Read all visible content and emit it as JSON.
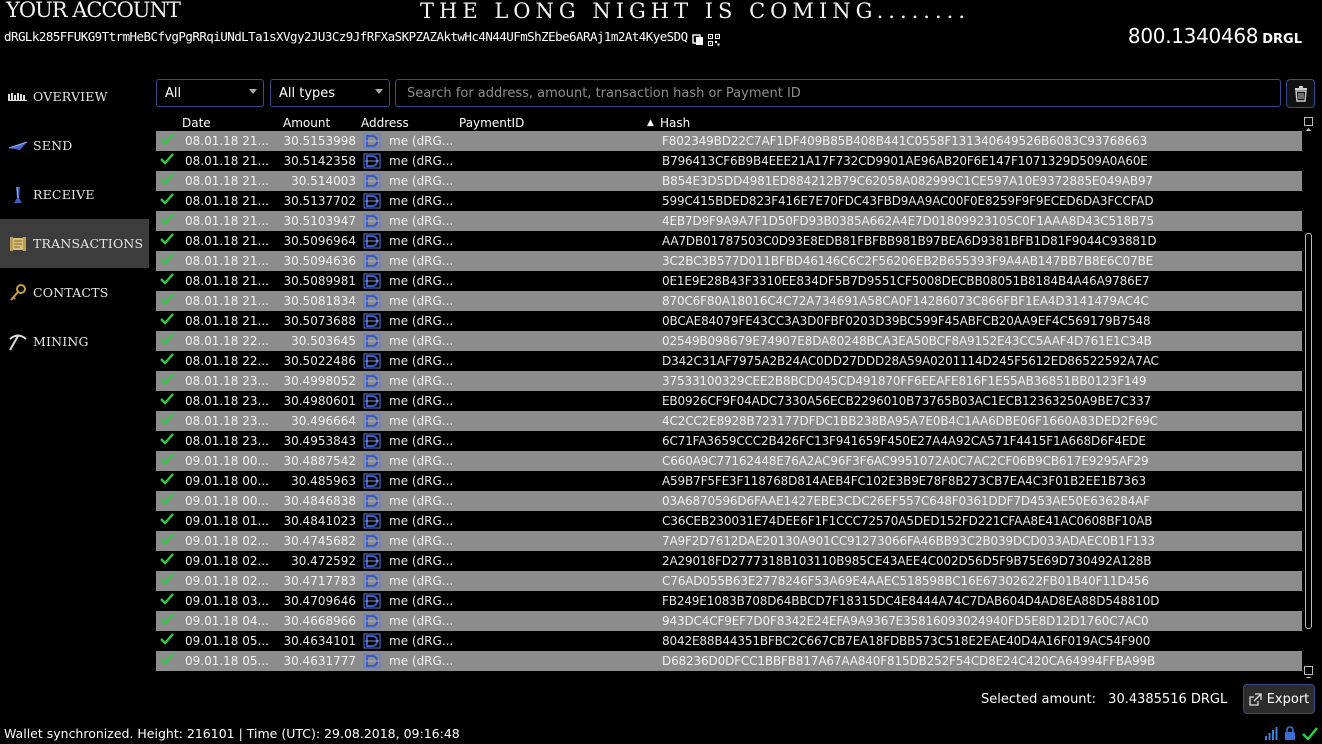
{
  "header": {
    "title": "YOUR ACCOUNT",
    "tagline": "THE LONG NIGHT IS COMING........",
    "address": "dRGLk285FFUKG9TtrmHeBCfvgPgRRqiUNdLTa1sXVgy2JU3Cz9JfRFXaSKPZAZAktwHc4N44UFmShZEbe6ARAj1m2At4KyeSDQ",
    "balance": "800.1340468",
    "ticker": "DRGL"
  },
  "sidebar": {
    "items": [
      {
        "label": "OVERVIEW",
        "icon": "overview-icon"
      },
      {
        "label": "SEND",
        "icon": "send-icon"
      },
      {
        "label": "RECEIVE",
        "icon": "receive-icon"
      },
      {
        "label": "TRANSACTIONS",
        "icon": "transactions-icon",
        "active": true
      },
      {
        "label": "CONTACTS",
        "icon": "contacts-icon"
      },
      {
        "label": "MINING",
        "icon": "mining-icon"
      }
    ]
  },
  "filters": {
    "period": "All",
    "type": "All types",
    "search_placeholder": "Search for address, amount, transaction hash or Payment ID"
  },
  "table": {
    "headers": {
      "date": "Date",
      "amount": "Amount",
      "address": "Address",
      "payment_id": "PaymentID",
      "hash": "Hash"
    },
    "rows": [
      {
        "date": "08.01.18 21...",
        "amount": "30.5153998",
        "address": "me (dRG...",
        "hash": "F802349BD22C7AF1DF409B85B408B441C0558F131340649526B6083C93768663"
      },
      {
        "date": "08.01.18 21...",
        "amount": "30.5142358",
        "address": "me (dRG...",
        "hash": "B796413CF6B9B4EEE21A17F732CD9901AE96AB20F6E147F1071329D509A0A60E"
      },
      {
        "date": "08.01.18 21...",
        "amount": "30.514003",
        "address": "me (dRG...",
        "hash": "B854E3D5DD4981ED884212B79C62058A082999C1CE597A10E9372885E049AB97"
      },
      {
        "date": "08.01.18 21...",
        "amount": "30.5137702",
        "address": "me (dRG...",
        "hash": "599C415BDED823F416E7E70FDC43FBD9AA9AC00F0E8259F9F9ECED6DA3FCCFAD"
      },
      {
        "date": "08.01.18 21...",
        "amount": "30.5103947",
        "address": "me (dRG...",
        "hash": "4EB7D9F9A9A7F1D50FD93B0385A662A4E7D01809923105C0F1AAA8D43C518B75"
      },
      {
        "date": "08.01.18 21...",
        "amount": "30.5096964",
        "address": "me (dRG...",
        "hash": "AA7DB01787503C0D93E8EDB81FBFBB981B97BEA6D9381BFB1D81F9044C93881D"
      },
      {
        "date": "08.01.18 21...",
        "amount": "30.5094636",
        "address": "me (dRG...",
        "hash": "3C2BC3B577D011BFBD46146C6C2F56206EB2B655393F9A4AB147BB7B8E6C07BE"
      },
      {
        "date": "08.01.18 21...",
        "amount": "30.5089981",
        "address": "me (dRG...",
        "hash": "0E1E9E28B43F3310EE834DF5B7D9551CF5008DECBB08051B8184B4A46A9786E7"
      },
      {
        "date": "08.01.18 21...",
        "amount": "30.5081834",
        "address": "me (dRG...",
        "hash": "870C6F80A18016C4C72A734691A58CA0F14286073C866FBF1EA4D3141479AC4C"
      },
      {
        "date": "08.01.18 21...",
        "amount": "30.5073688",
        "address": "me (dRG...",
        "hash": "0BCAE84079FE43CC3A3D0FBF0203D39BC599F45ABFCB20AA9EF4C569179B7548"
      },
      {
        "date": "08.01.18 22...",
        "amount": "30.503645",
        "address": "me (dRG...",
        "hash": "02549B098679E74907E8DA80248BCA3EA50BCF8A9152E43CC5AAF4D761E1C34B"
      },
      {
        "date": "08.01.18 22...",
        "amount": "30.5022486",
        "address": "me (dRG...",
        "hash": "D342C31AF7975A2B24AC0DD27DDD28A59A0201114D245F5612ED86522592A7AC"
      },
      {
        "date": "08.01.18 23...",
        "amount": "30.4998052",
        "address": "me (dRG...",
        "hash": "37533100329CEE2B8BCD045CD491870FF6EEAFE816F1E55AB36851BB0123F149"
      },
      {
        "date": "08.01.18 23...",
        "amount": "30.4980601",
        "address": "me (dRG...",
        "hash": "EB0926CF9F04ADC7330A56ECB2296010B73765B03AC1ECB12363250A9BE7C337"
      },
      {
        "date": "08.01.18 23...",
        "amount": "30.496664",
        "address": "me (dRG...",
        "hash": "4C2CC2E8928B723177DFDC1BB238BA95A7E0B4C1AA6DBE06F1660A83DED2F69C"
      },
      {
        "date": "08.01.18 23...",
        "amount": "30.4953843",
        "address": "me (dRG...",
        "hash": "6C71FA3659CCC2B426FC13F941659F450E27A4A92CA571F4415F1A668D6F4EDE"
      },
      {
        "date": "09.01.18 00...",
        "amount": "30.4887542",
        "address": "me (dRG...",
        "hash": "C660A9C77162448E76A2AC96F3F6AC9951072A0C7AC2CF06B9CB617E9295AF29"
      },
      {
        "date": "09.01.18 00...",
        "amount": "30.485963",
        "address": "me (dRG...",
        "hash": "A59B7F5FE3F118768D814AEB4FC102E3B9E78F8B273CB7EA4C3F01B2EE1B7363"
      },
      {
        "date": "09.01.18 00...",
        "amount": "30.4846838",
        "address": "me (dRG...",
        "hash": "03A6870596D6FAAE1427EBE3CDC26EF557C648F0361DDF7D453AE50E636284AF"
      },
      {
        "date": "09.01.18 01...",
        "amount": "30.4841023",
        "address": "me (dRG...",
        "hash": "C36CEB230031E74DEE6F1F1CCC72570A5DED152FD221CFAA8E41AC0608BF10AB"
      },
      {
        "date": "09.01.18 02...",
        "amount": "30.4745682",
        "address": "me (dRG...",
        "hash": "7A9F2D7612DAE20130A901CC91273066FA46BB93C2B039DCD033ADAEC0B1F133"
      },
      {
        "date": "09.01.18 02...",
        "amount": "30.472592",
        "address": "me (dRG...",
        "hash": "2A29018FD2777318B103110B985CE43AEE4C002D56D5F9B75E69D730492A128B"
      },
      {
        "date": "09.01.18 02...",
        "amount": "30.4717783",
        "address": "me (dRG...",
        "hash": "C76AD055B63E2778246F53A69E4AAEC518598BC16E67302622FB01B40F11D456"
      },
      {
        "date": "09.01.18 03...",
        "amount": "30.4709646",
        "address": "me (dRG...",
        "hash": "FB249E1083B708D64BBCD7F18315DC4E8444A74C7DAB604D4AD8EA88D548810D"
      },
      {
        "date": "09.01.18 04...",
        "amount": "30.4668966",
        "address": "me (dRG...",
        "hash": "943DC4CF9EF7D0F8342E24EFA9A9367E35816093024940FD5E8D12D1760C7AC0"
      },
      {
        "date": "09.01.18 05...",
        "amount": "30.4634101",
        "address": "me (dRG...",
        "hash": "8042E88B44351BFBC2C667CB7EA18FDBB573C518E2EAE40D4A16F019AC54F900"
      },
      {
        "date": "09.01.18 05...",
        "amount": "30.4631777",
        "address": "me (dRG...",
        "hash": "D68236D0DFCC1BBFB817A67AA840F815DB252F54CD8E24C420CA64994FFBA99B"
      }
    ]
  },
  "footer": {
    "selected_label": "Selected amount:",
    "selected_value": "30.4385516 DRGL",
    "export_label": "Export",
    "status_text": "Wallet synchronized. Height: 216101  |  Time (UTC): 29.08.2018, 09:16:48"
  },
  "colors": {
    "row_gray": "#8c8c8c",
    "accent_border": "#3a4b8c",
    "check_green": "#2ecc40"
  }
}
